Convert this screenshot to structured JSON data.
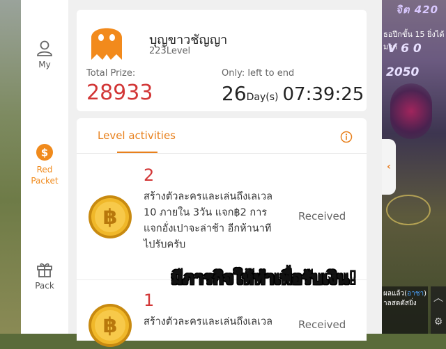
{
  "game": {
    "hud_top": "จิต 420",
    "hud_line2": "ธอปีกขั้น 15 ยิ่งได้มาก",
    "hud_line3": "V 6 0",
    "hud_line4": "2050",
    "tab_arrow": "‹",
    "chat_line1": "ผลแล้ว(",
    "chat_link": "อาชา",
    "chat_line1_end": ")",
    "chat_line2": "าลสดตัสยิ่ง",
    "gear_top": "︿",
    "gear_bottom": "⚙"
  },
  "sidebar": {
    "items": [
      {
        "label": "My",
        "icon": "user-icon"
      },
      {
        "label": "Red Packet",
        "icon": "dollar-coin-icon",
        "active": true
      },
      {
        "label": "Pack",
        "icon": "gift-icon"
      }
    ]
  },
  "profile": {
    "username": "บุญขาวชัญญา",
    "level": "223Level",
    "total_prize_label": "Total Prize:",
    "total_prize_value": "28933",
    "countdown_label": "Only: left to end",
    "countdown_days": "26",
    "countdown_days_unit": "Day(s)",
    "countdown_time": "07:39:25"
  },
  "activities": {
    "tab_label": "Level activities",
    "items": [
      {
        "number": "2",
        "description": "สร้างตัวละครและเล่นถึงเลเวล 10 ภายใน 3วัน แจก฿2 การแจกอั่งเปาจะล่าช้า อีกห้านาทีไปรับครับ",
        "status": "Received"
      },
      {
        "number": "1",
        "description": "สร้างตัวละครและเล่นถึงเลเวล",
        "status": "Received"
      }
    ]
  },
  "caption": "มีภารกิจให้ทำเพื่อรับเงิน!",
  "colors": {
    "accent": "#e8801c",
    "prize": "#d23636",
    "avatar": "#f28a1c",
    "coin": "#e8a81c"
  }
}
